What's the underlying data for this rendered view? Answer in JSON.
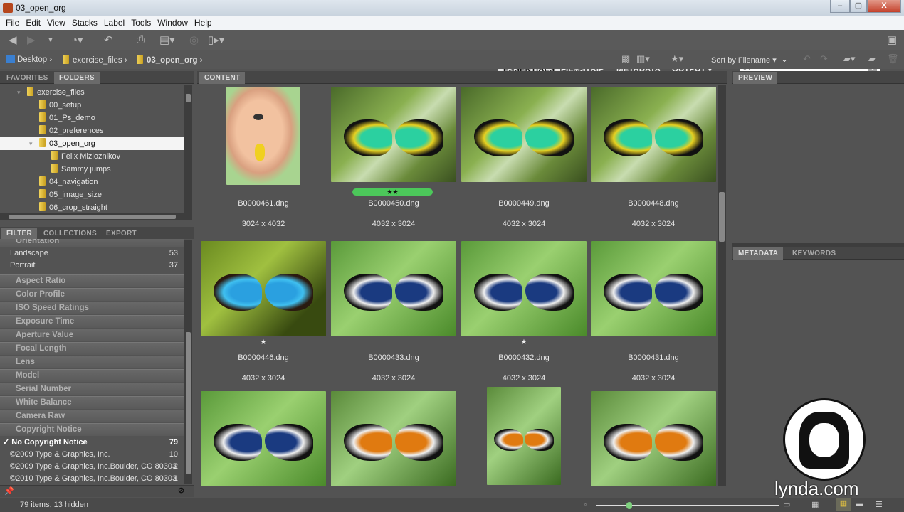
{
  "window": {
    "title": "03_open_org",
    "minimize": "–",
    "maximize": "▢",
    "close": "X"
  },
  "menu": [
    "File",
    "Edit",
    "View",
    "Stacks",
    "Label",
    "Tools",
    "Window",
    "Help"
  ],
  "workspaces": {
    "essentials": "ESSENTIALS",
    "filmstrip": "FILMSTRIP",
    "metadata": "METADATA",
    "output": "OUTPUT ▾"
  },
  "search": {
    "value": "",
    "icon": "⌕▾"
  },
  "breadcrumb": [
    {
      "label": "Desktop"
    },
    {
      "label": "exercise_files"
    },
    {
      "label": "03_open_org"
    }
  ],
  "sort": {
    "label": "Sort by Filename ▾"
  },
  "left_tabs": {
    "favorites": "FAVORITES",
    "folders": "FOLDERS"
  },
  "folders": [
    {
      "label": "exercise_files",
      "level": 0
    },
    {
      "label": "00_setup",
      "level": 1
    },
    {
      "label": "01_Ps_demo",
      "level": 1
    },
    {
      "label": "02_preferences",
      "level": 1
    },
    {
      "label": "03_open_org",
      "level": 1,
      "selected": true
    },
    {
      "label": "Felix Mizioznikov",
      "level": 2
    },
    {
      "label": "Sammy jumps",
      "level": 2
    },
    {
      "label": "04_navigation",
      "level": 1
    },
    {
      "label": "05_image_size",
      "level": 1
    },
    {
      "label": "06_crop_straight",
      "level": 1
    }
  ],
  "filter_tabs": {
    "filter": "FILTER",
    "collections": "COLLECTIONS",
    "export": "EXPORT"
  },
  "filter": {
    "orientation": {
      "title": "Orientation",
      "items": [
        {
          "label": "Landscape",
          "count": "53"
        },
        {
          "label": "Portrait",
          "count": "37"
        }
      ]
    },
    "sections": [
      "Aspect Ratio",
      "Color Profile",
      "ISO Speed Ratings",
      "Exposure Time",
      "Aperture Value",
      "Focal Length",
      "Lens",
      "Model",
      "Serial Number",
      "White Balance",
      "Camera Raw"
    ],
    "copyright": {
      "title": "Copyright Notice",
      "items": [
        {
          "label": "✓ No Copyright Notice",
          "count": "79",
          "checked": true
        },
        {
          "label": "©2009 Type & Graphics, Inc.",
          "count": "10"
        },
        {
          "label": "©2009 Type & Graphics, Inc.Boulder, CO 80303",
          "count": "2"
        },
        {
          "label": "©2010 Type & Graphics, Inc.Boulder, CO 80303",
          "count": "1"
        }
      ]
    }
  },
  "content_tab": "CONTENT",
  "thumbnails": [
    {
      "name": "B0000461.dng",
      "dims": "3024 x 4032",
      "kind": "portrait-boy",
      "stars": "",
      "label": ""
    },
    {
      "name": "B0000450.dng",
      "dims": "4032 x 3024",
      "kind": "birdwing",
      "stars": "★★",
      "label": "green"
    },
    {
      "name": "B0000449.dng",
      "dims": "4032 x 3024",
      "kind": "birdwing",
      "stars": "",
      "label": ""
    },
    {
      "name": "B0000448.dng",
      "dims": "4032 x 3024",
      "kind": "birdwing",
      "stars": "",
      "label": ""
    },
    {
      "name": "B0000446.dng",
      "dims": "4032 x 3024",
      "kind": "morpho",
      "stars": "★",
      "label": ""
    },
    {
      "name": "B0000433.dng",
      "dims": "4032 x 3024",
      "kind": "blue-white",
      "stars": "",
      "label": ""
    },
    {
      "name": "B0000432.dng",
      "dims": "4032 x 3024",
      "kind": "blue-white",
      "stars": "★",
      "label": ""
    },
    {
      "name": "B0000431.dng",
      "dims": "4032 x 3024",
      "kind": "blue-white",
      "stars": "",
      "label": ""
    },
    {
      "name": "",
      "dims": "",
      "kind": "blue-white",
      "stars": "",
      "label": ""
    },
    {
      "name": "",
      "dims": "",
      "kind": "orange",
      "stars": "",
      "label": ""
    },
    {
      "name": "",
      "dims": "",
      "kind": "orange-portrait",
      "stars": "",
      "label": ""
    },
    {
      "name": "",
      "dims": "",
      "kind": "orange",
      "stars": "",
      "label": ""
    }
  ],
  "right_tabs": {
    "preview": "PREVIEW",
    "metadata": "METADATA",
    "keywords": "KEYWORDS"
  },
  "status": {
    "text": "79 items, 13 hidden",
    "thumb_size": 0.18
  },
  "watermark": "lynda.com"
}
